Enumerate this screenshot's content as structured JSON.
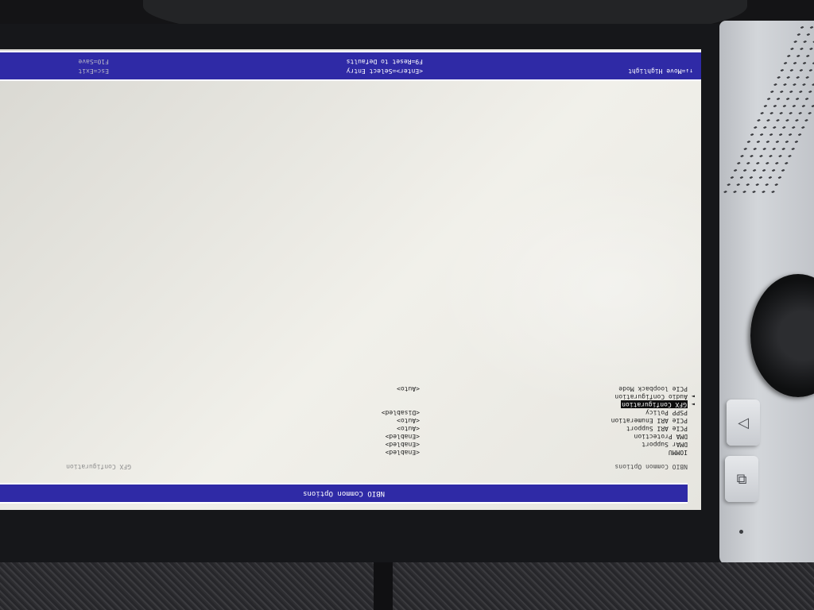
{
  "bios": {
    "title": "NBIO Common Options",
    "breadcrumb_left": "NBIO Common Options",
    "breadcrumb_right": "GFX Configuration",
    "settings": [
      {
        "label": "IOMMU",
        "value": "<Enabled>",
        "submenu": false,
        "selected": false
      },
      {
        "label": "DMAr Support",
        "value": "<Enabled>",
        "submenu": false,
        "selected": false
      },
      {
        "label": "DMA Protection",
        "value": "<Enabled>",
        "submenu": false,
        "selected": false
      },
      {
        "label": "PCIe ARI Support",
        "value": "<Auto>",
        "submenu": false,
        "selected": false
      },
      {
        "label": "PCIe ARI Enumeration",
        "value": "<Auto>",
        "submenu": false,
        "selected": false
      },
      {
        "label": "PSPP Policy",
        "value": "<Disabled>",
        "submenu": false,
        "selected": false
      },
      {
        "label": "GFX Configuration",
        "value": "",
        "submenu": true,
        "selected": true
      },
      {
        "label": "Audio Configuration",
        "value": "",
        "submenu": true,
        "selected": false
      },
      {
        "label": "PCIe loopback Mode",
        "value": "<Auto>",
        "submenu": false,
        "selected": false
      }
    ],
    "help": {
      "move": "↑↓=Move Highlight",
      "select": "<Enter>=Select Entry",
      "reset": "F9=Reset to Defaults",
      "exit": "Esc=Exit",
      "save": "F10=Save"
    },
    "colors": {
      "bar": "#2f2aa6",
      "screen_bg": "#ecebe5",
      "text": "#202020"
    }
  },
  "hardware": {
    "button_triangle_icon": "triangle-icon",
    "button_windows_icon": "windows-switch-icon"
  }
}
